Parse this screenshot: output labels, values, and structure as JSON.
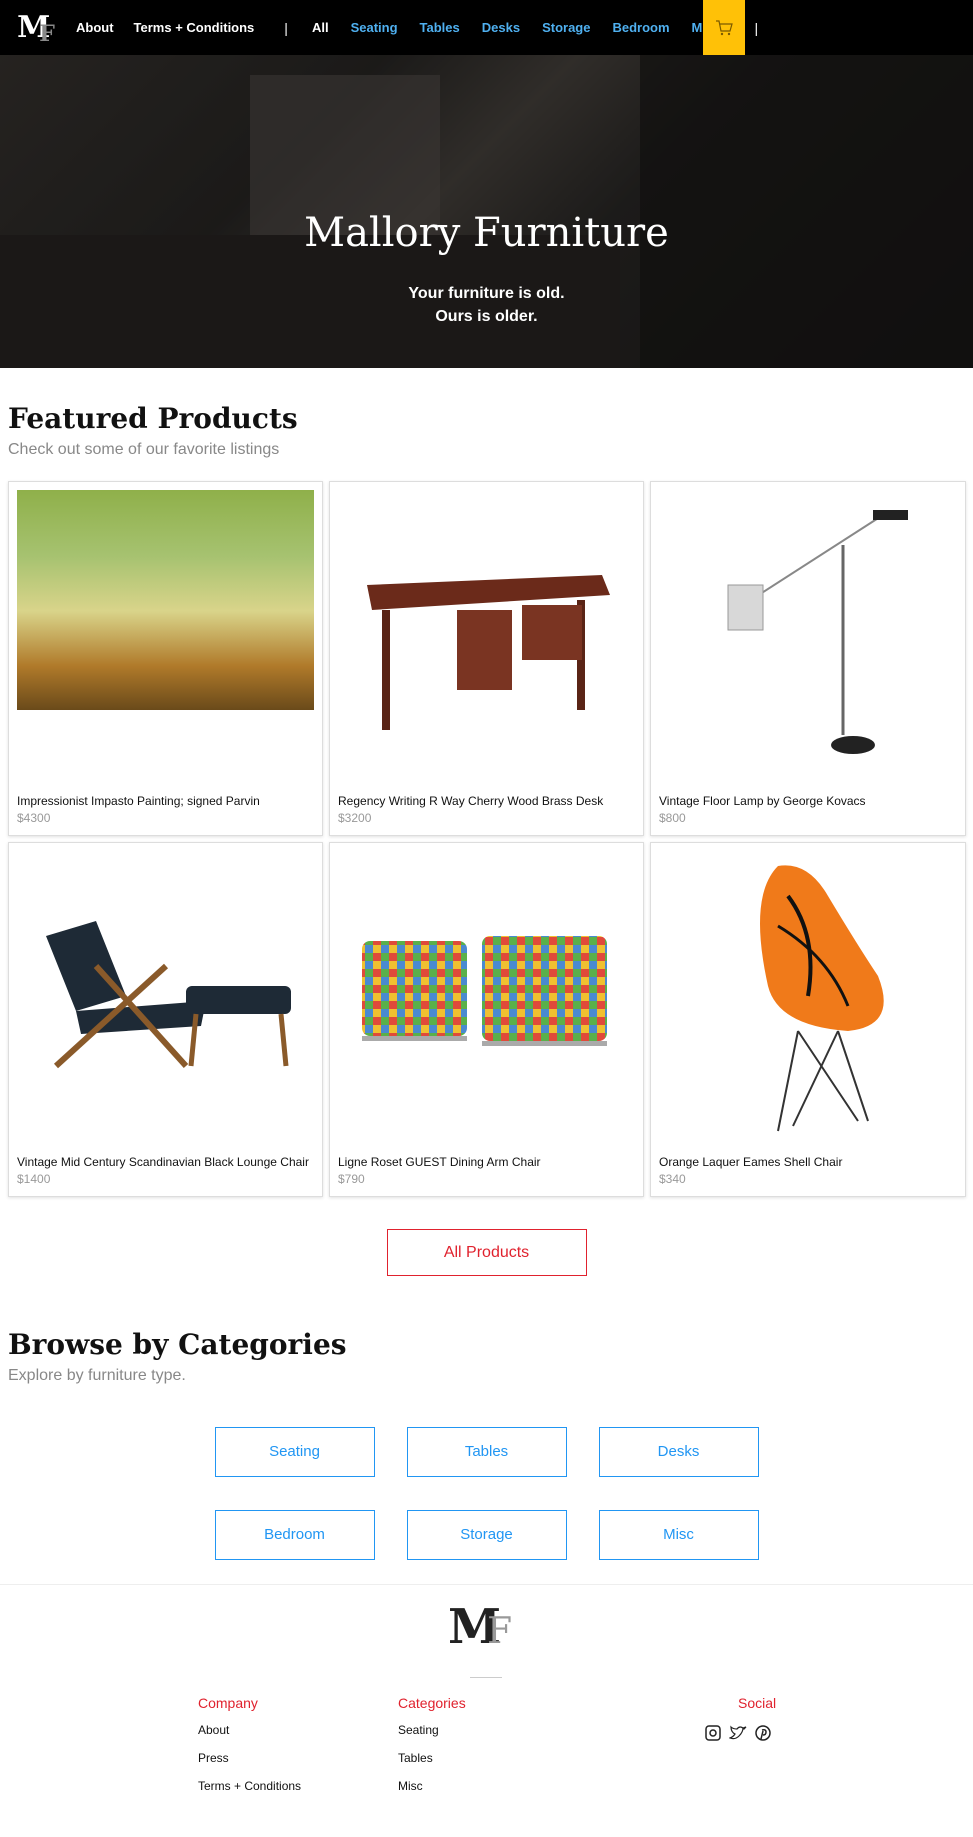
{
  "nav": {
    "logo": "MF",
    "links": [
      "About",
      "Terms + Conditions"
    ],
    "separator": "|",
    "all": "All",
    "categories": [
      "Seating",
      "Tables",
      "Desks",
      "Storage",
      "Bedroom",
      "Misc"
    ],
    "cart_icon": "shopping-cart-icon",
    "cart_bg": "#ffc107"
  },
  "hero": {
    "title": "Mallory Furniture",
    "tagline_1": "Your furniture is old.",
    "tagline_2": "Ours is older."
  },
  "featured": {
    "title": "Featured Products",
    "subtitle": "Check out some of our favorite listings",
    "products": [
      {
        "name": "Impressionist Impasto Painting; signed Parvin",
        "price": "$4300"
      },
      {
        "name": "Regency Writing R Way Cherry Wood Brass Desk",
        "price": "$3200"
      },
      {
        "name": "Vintage Floor Lamp by George Kovacs",
        "price": "$800"
      },
      {
        "name": "Vintage Mid Century Scandinavian Black Lounge Chair",
        "price": "$1400"
      },
      {
        "name": "Ligne Roset GUEST Dining Arm Chair",
        "price": "$790"
      },
      {
        "name": "Orange Laquer Eames Shell Chair",
        "price": "$340"
      }
    ],
    "all_button": "All Products"
  },
  "browse": {
    "title": "Browse by Categories",
    "subtitle": "Explore by furniture type.",
    "categories": [
      "Seating",
      "Tables",
      "Desks",
      "Bedroom",
      "Storage",
      "Misc"
    ]
  },
  "footer": {
    "logo": "MF",
    "company": {
      "heading": "Company",
      "links": [
        "About",
        "Press",
        "Terms + Conditions"
      ]
    },
    "categories": {
      "heading": "Categories",
      "links": [
        "Seating",
        "Tables",
        "Misc"
      ]
    },
    "social": {
      "heading": "Social",
      "icons": [
        "instagram-icon",
        "twitter-icon",
        "pinterest-icon"
      ]
    }
  },
  "colors": {
    "accent_red": "#e0222e",
    "accent_blue": "#2196f3",
    "nav_blue": "#4fb0f0"
  }
}
